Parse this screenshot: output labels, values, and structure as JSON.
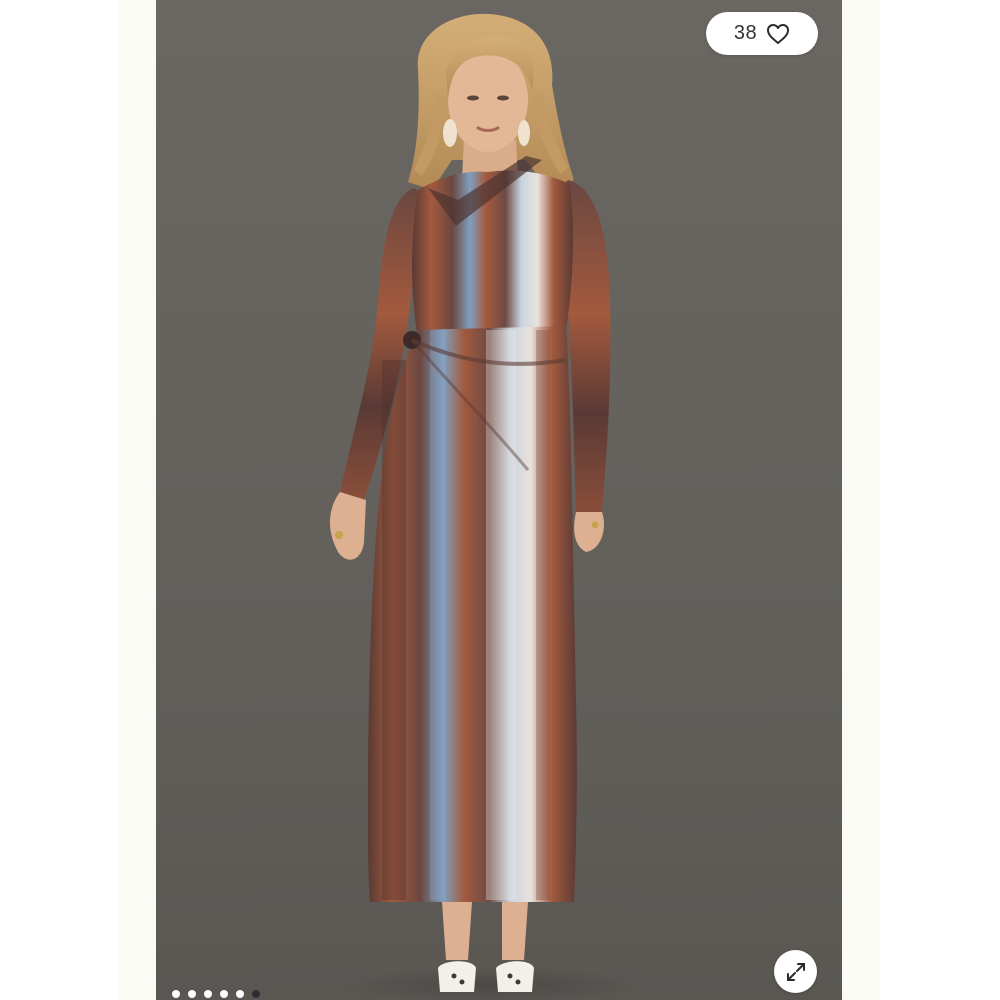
{
  "gallery": {
    "like_count": "38",
    "like_icon": "heart-icon",
    "expand_icon": "expand-arrows-icon",
    "dots_total": 6,
    "dots_active_index": 5
  },
  "colors": {
    "backdrop": "#65625e",
    "page_margin": "#fbfbf6",
    "dress_rust": "#a35a3e",
    "dress_brown": "#5a3a35",
    "dress_blue": "#7f9fbe",
    "dress_cream": "#e9e2dc",
    "hair": "#c8a068",
    "skin": "#e2b896",
    "dot_active": "#2c2c36"
  }
}
